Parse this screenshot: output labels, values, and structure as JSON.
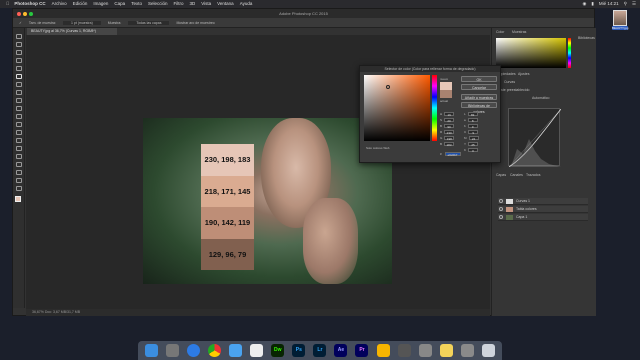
{
  "menubar": {
    "app": "Photoshop CC",
    "items": [
      "Archivo",
      "Edición",
      "Imagen",
      "Capa",
      "Texto",
      "Selección",
      "Filtro",
      "3D",
      "Vista",
      "Ventana",
      "Ayuda"
    ],
    "clock": "Mié 14:21"
  },
  "window": {
    "title": "Adobe Photoshop CC 2015",
    "doc_tab": "BEAUTY.jpg al 36,7% (Curvas 1, RGB/8*)",
    "status": "36,67%   Doc: 3,67 MB/31,7 MB"
  },
  "options_bar": [
    "Tam. de muestra:",
    "1 pt (muestra)",
    "Muestra:",
    "Todas las capas",
    "Mostrar aro de muestreo"
  ],
  "swatches": [
    {
      "label": "230, 198, 183",
      "color": "#e6c6b7"
    },
    {
      "label": "218, 171, 145",
      "color": "#daab91"
    },
    {
      "label": "190, 142, 119",
      "color": "#be8e77"
    },
    {
      "label": "129, 96, 79",
      "color": "#81604f"
    }
  ],
  "color_picker": {
    "title": "Selector de color (Color para rellenar forma de degradado)",
    "new_label": "nuevo",
    "current_label": "actual",
    "ok": "OK",
    "cancel": "Cancelar",
    "add_to_swatches": "Añadir a muestras",
    "libraries": "Bibliotecas de colores",
    "web_only": "Solo colores Web",
    "hex": "e6c6b7",
    "values": {
      "H": "19",
      "S": "20",
      "B": "90",
      "R": "230",
      "G": "198",
      "Bv": "183",
      "L": "83",
      "a": "8",
      "b": "9",
      "C": "9",
      "M": "24",
      "Y": "25",
      "K": "0"
    }
  },
  "panels": {
    "color_tabs": [
      "Color",
      "Muestras"
    ],
    "props_tabs": [
      "Propiedades",
      "Ajustes"
    ],
    "props_title": "Curvas",
    "preset": "Ajuste preestablecido",
    "auto": "Automático",
    "layers_tabs": [
      "Capas",
      "Canales",
      "Trazados"
    ],
    "layers": [
      {
        "name": "Curvas 1",
        "thumb": "#dddddd"
      },
      {
        "name": "Tabla colores",
        "thumb": "#c39480"
      },
      {
        "name": "Capa 1",
        "thumb": "#5a6b4a"
      }
    ],
    "libraries_label": "Bibliotecas"
  },
  "desktop_file": "BEAUTY.jpg",
  "dock": [
    "Finder",
    "Launchpad",
    "Safari",
    "Chrome",
    "Mail",
    "Fotos",
    "Dw",
    "Ps",
    "Lr",
    "Ae",
    "Pr",
    "Sketch",
    "Cámara",
    "Ajustes",
    "Notas",
    "Preferencias",
    "Papelera"
  ]
}
